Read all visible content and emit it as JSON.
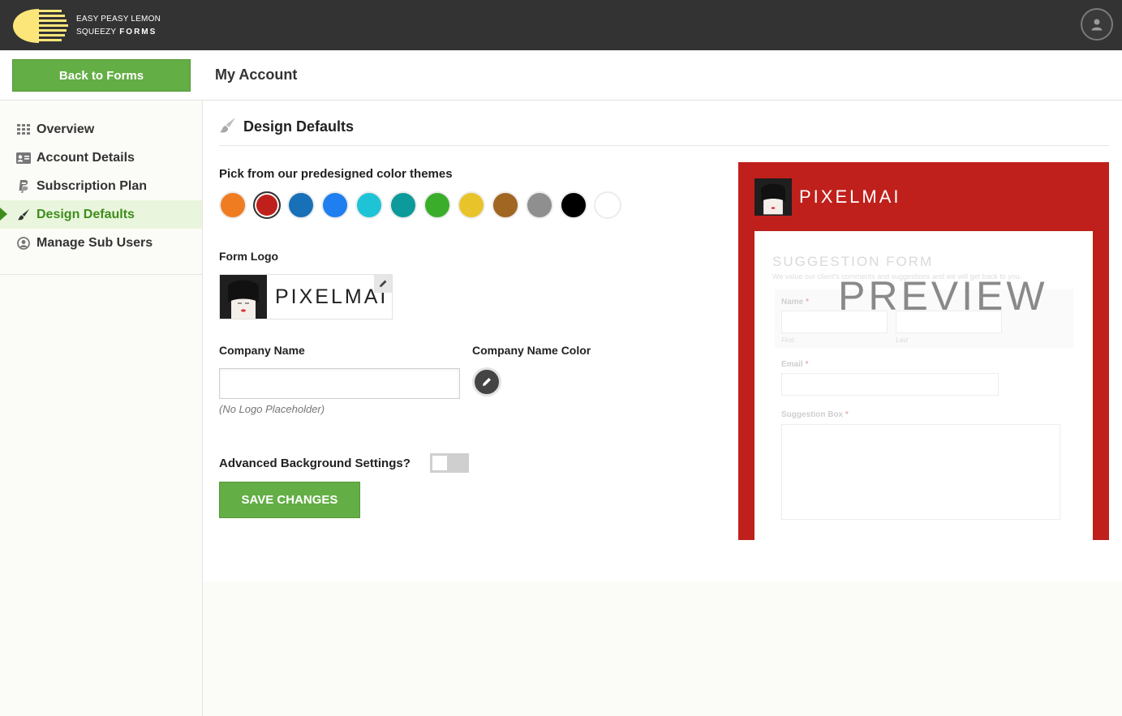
{
  "app": {
    "brand_line1": "EASY PEASY LEMON",
    "brand_line2": "SQUEEZY",
    "brand_forms": "FORMS",
    "user_icon": "user-icon"
  },
  "header": {
    "back_label": "Back to Forms",
    "page_title": "My Account"
  },
  "sidebar": {
    "items": [
      {
        "label": "Overview",
        "icon": "grid-icon",
        "active": false
      },
      {
        "label": "Account Details",
        "icon": "id-card-icon",
        "active": false
      },
      {
        "label": "Subscription Plan",
        "icon": "paypal-icon",
        "active": false
      },
      {
        "label": "Design Defaults",
        "icon": "paintbrush-icon",
        "active": true
      },
      {
        "label": "Manage Sub Users",
        "icon": "user-circle-icon",
        "active": false
      }
    ]
  },
  "main": {
    "section_title": "Design Defaults",
    "themes_label": "Pick from our predesigned color themes",
    "themes": [
      {
        "color": "#f07c22",
        "selected": false
      },
      {
        "color": "#c0201b",
        "selected": true
      },
      {
        "color": "#1870b8",
        "selected": false
      },
      {
        "color": "#1f7ff0",
        "selected": false
      },
      {
        "color": "#1ec4d6",
        "selected": false
      },
      {
        "color": "#0d9a9a",
        "selected": false
      },
      {
        "color": "#3aae2a",
        "selected": false
      },
      {
        "color": "#e8c42a",
        "selected": false
      },
      {
        "color": "#a06622",
        "selected": false
      },
      {
        "color": "#8f8f8f",
        "selected": false
      },
      {
        "color": "#000000",
        "selected": false
      },
      {
        "color": "#ffffff",
        "selected": false
      }
    ],
    "form_logo_label": "Form Logo",
    "logo_word": "PIXELMAI",
    "company_name_label": "Company Name",
    "company_name_value": "",
    "company_name_hint": "(No Logo Placeholder)",
    "company_color_label": "Company Name Color",
    "advanced_label": "Advanced Background Settings?",
    "advanced_on": false,
    "save_label": "SAVE CHANGES"
  },
  "preview": {
    "company": "PIXELMAI",
    "form_title": "SUGGESTION FORM",
    "form_subtitle": "We value our client's comments and suggestions and we will get back to you.",
    "name_label": "Name",
    "first_label": "First",
    "last_label": "Last",
    "email_label": "Email",
    "suggestion_label": "Suggestion Box",
    "required_mark": "*",
    "watermark": "PREVIEW",
    "accent": "#c0201b"
  }
}
